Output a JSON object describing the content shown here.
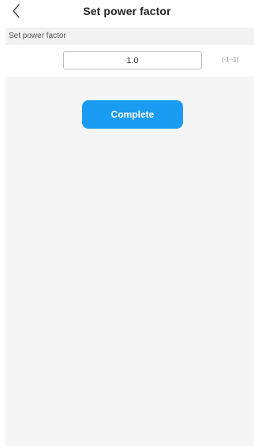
{
  "header": {
    "title": "Set power factor",
    "back_icon": "chevron-left-icon"
  },
  "power_factor": {
    "section_label": "Set power factor",
    "value": "1.0",
    "range_hint": "(-1~1)"
  },
  "actions": {
    "complete_label": "Complete"
  },
  "colors": {
    "accent": "#1a9cf2",
    "section_bg": "#f2f2f2",
    "content_bg": "#f5f5f5"
  }
}
